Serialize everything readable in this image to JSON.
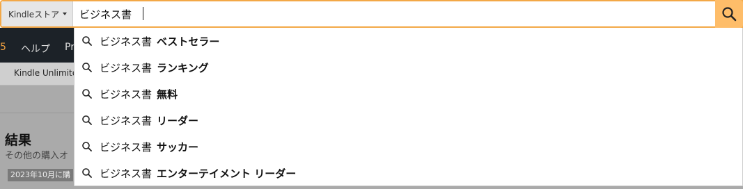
{
  "search": {
    "scope_label": "Kindleストア",
    "query": "ビジネス書",
    "button_label": ""
  },
  "background": {
    "nav_items": [
      "ヘルプ",
      "Pr"
    ],
    "nav_partial_first": "5",
    "subnav_item": "Kindle Unlimite",
    "results_heading": "結果",
    "results_sub": "その他の購入オ",
    "date_badge": "2023年10月に購"
  },
  "suggestions": [
    {
      "prefix": "ビジネス書",
      "suffix": "ベストセラー"
    },
    {
      "prefix": "ビジネス書",
      "suffix": "ランキング"
    },
    {
      "prefix": "ビジネス書",
      "suffix": "無料"
    },
    {
      "prefix": "ビジネス書",
      "suffix": "リーダー"
    },
    {
      "prefix": "ビジネス書",
      "suffix": "サッカー"
    },
    {
      "prefix": "ビジネス書",
      "suffix": "エンターテイメント リーダー"
    }
  ],
  "icons": {
    "search_button": "search-icon",
    "suggestion": "search-icon",
    "scope_caret": "caret-down-icon"
  },
  "colors": {
    "search_border": "#f3a847",
    "search_button": "#febd69",
    "nav_dark": "#1c2228",
    "overlay": "#aaaaaa"
  }
}
